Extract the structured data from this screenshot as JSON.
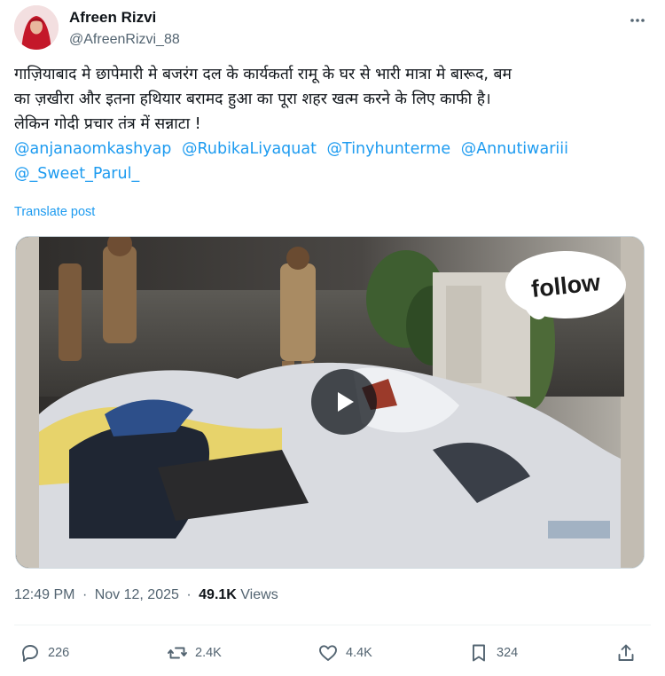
{
  "author": {
    "display_name": "Afreen Rizvi",
    "handle": "@AfreenRizvi_88"
  },
  "post": {
    "text_lines": [
      "गाज़ियाबाद मे छापेमारी मे बजरंग दल के कार्यकर्ता रामू के घर से भारी मात्रा मे बारूद, बम",
      "का ज़खीरा और इतना हथियार बरामद हुआ का पूरा शहर खत्म करने के लिए काफी है।",
      "लेकिन गोदी प्रचार तंत्र में सन्नाटा !"
    ],
    "mentions": [
      "@anjanaomkashyap",
      "@RubikaLiyaquat",
      "@Tinyhunterme",
      "@Annutiwariii",
      "@_Sweet_Parul_"
    ],
    "translate_label": "Translate post"
  },
  "media": {
    "overlay_text": "follow",
    "play_icon": "play-icon"
  },
  "meta": {
    "time": "12:49 PM",
    "date": "Nov 12, 2025",
    "separator": "·",
    "views_count": "49.1K",
    "views_label": "Views"
  },
  "actions": {
    "reply_count": "226",
    "repost_count": "2.4K",
    "like_count": "4.4K",
    "bookmark_count": "324"
  },
  "colors": {
    "link": "#1d9bf0",
    "muted": "#536471",
    "text": "#0f1419"
  }
}
